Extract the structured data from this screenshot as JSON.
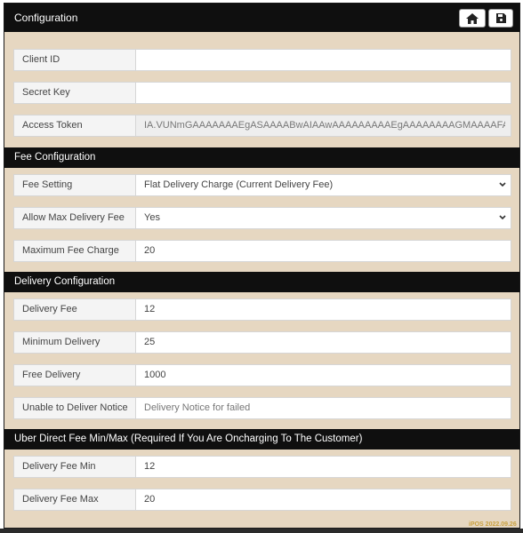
{
  "header": {
    "title": "Configuration",
    "home_icon": "home-icon",
    "save_icon": "save-icon"
  },
  "configuration": {
    "client_id": {
      "label": "Client ID",
      "value": ""
    },
    "secret_key": {
      "label": "Secret Key",
      "value": ""
    },
    "access_token": {
      "label": "Access Token",
      "value": "IA.VUNmGAAAAAAAEgASAAAABwAIAAwAAAAAAAAAEgAAAAAAAAGMAAAAFA"
    }
  },
  "fee_configuration": {
    "title": "Fee Configuration",
    "fee_setting": {
      "label": "Fee Setting",
      "value": "Flat Delivery Charge (Current Delivery Fee)"
    },
    "allow_max": {
      "label": "Allow Max Delivery Fee",
      "value": "Yes"
    },
    "max_fee": {
      "label": "Maximum Fee Charge",
      "value": "20"
    }
  },
  "delivery_configuration": {
    "title": "Delivery Configuration",
    "delivery_fee": {
      "label": "Delivery Fee",
      "value": "12"
    },
    "minimum_delivery": {
      "label": "Minimum Delivery",
      "value": "25"
    },
    "free_delivery": {
      "label": "Free Delivery",
      "value": "1000"
    },
    "unable_notice": {
      "label": "Unable to Deliver Notice",
      "placeholder": "Delivery Notice for failed"
    }
  },
  "uber_direct": {
    "title": "Uber Direct Fee Min/Max (Required If You Are Oncharging To The Customer)",
    "fee_min": {
      "label": "Delivery Fee Min",
      "value": "12"
    },
    "fee_max": {
      "label": "Delivery Fee Max",
      "value": "20"
    }
  },
  "footer": {
    "version": "iPOS 2022.09.26"
  },
  "colors": {
    "panel_bg": "#e6d7c1",
    "bar_bg": "#0f0f0f"
  }
}
